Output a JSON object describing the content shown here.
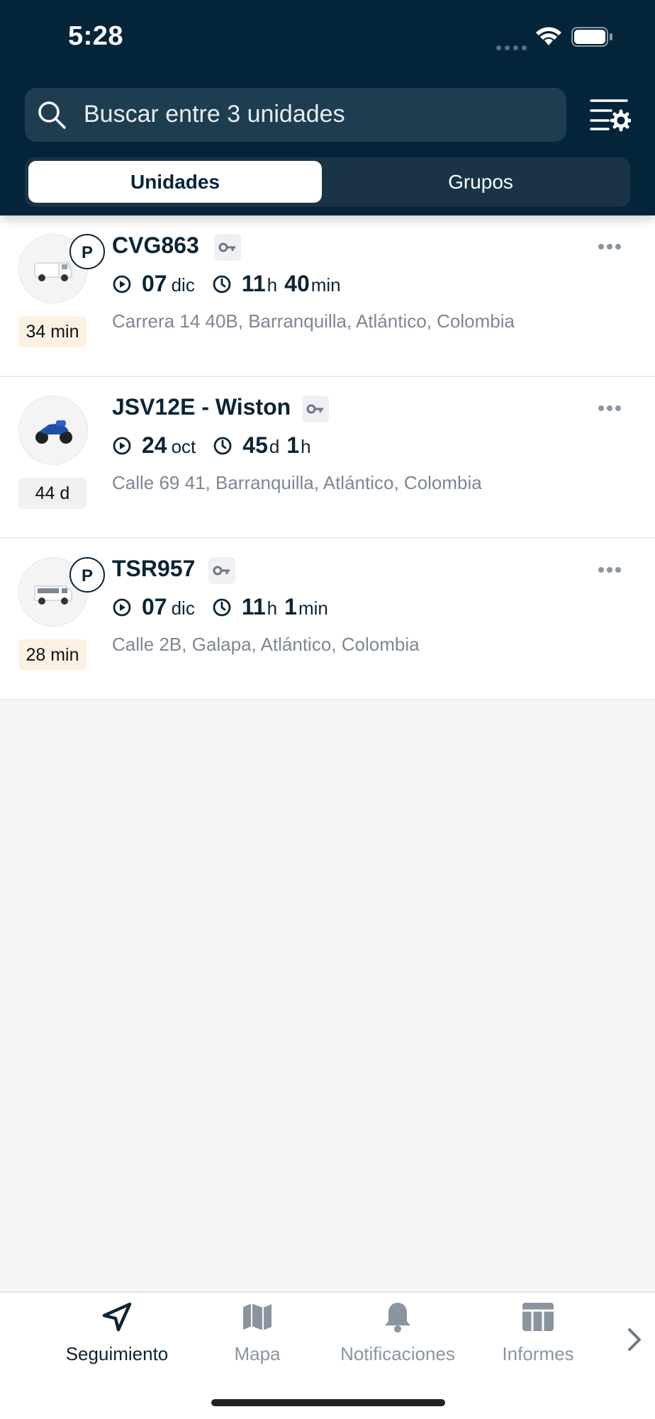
{
  "status_bar": {
    "time": "5:28"
  },
  "search": {
    "placeholder": "Buscar entre 3 unidades"
  },
  "segments": {
    "units": "Unidades",
    "groups": "Grupos"
  },
  "units": [
    {
      "name": "CVG863",
      "parked": true,
      "age": "34 min",
      "age_status": "warn",
      "date_num": "07",
      "date_month": "dic",
      "dur_a": "11",
      "dur_a_unit": "h",
      "dur_b": "40",
      "dur_b_unit": "min",
      "address": "Carrera 14 40B, Barranquilla, Atlántico, Colombia",
      "image": "white-van"
    },
    {
      "name": "JSV12E - Wiston",
      "parked": false,
      "age": "44 d",
      "age_status": "grey",
      "date_num": "24",
      "date_month": "oct",
      "dur_a": "45",
      "dur_a_unit": "d",
      "dur_b": "1",
      "dur_b_unit": "h",
      "address": "Calle 69 41, Barranquilla, Atlántico, Colombia",
      "image": "blue-motorcycle"
    },
    {
      "name": "TSR957",
      "parked": true,
      "age": "28 min",
      "age_status": "warn",
      "date_num": "07",
      "date_month": "dic",
      "dur_a": "11",
      "dur_a_unit": "h",
      "dur_b": "1",
      "dur_b_unit": "min",
      "address": "Calle 2B, Galapa, Atlántico, Colombia",
      "image": "white-minibus"
    }
  ],
  "parked_badge": "P",
  "tabbar": {
    "items": [
      {
        "label": "Seguimiento",
        "icon": "navigation-arrow-icon",
        "active": true
      },
      {
        "label": "Mapa",
        "icon": "map-icon",
        "active": false
      },
      {
        "label": "Notificaciones",
        "icon": "bell-icon",
        "active": false
      },
      {
        "label": "Informes",
        "icon": "table-icon",
        "active": false
      }
    ]
  },
  "colors": {
    "header_bg": "#04243a",
    "accent": "#0b2436",
    "age_warn_bg": "#fdf1e3"
  }
}
